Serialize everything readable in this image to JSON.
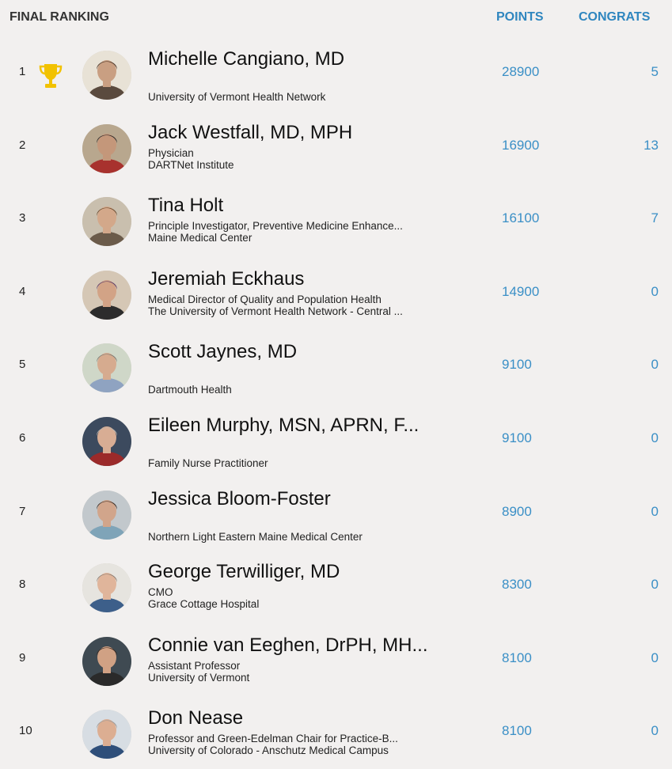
{
  "header": {
    "title": "FINAL RANKING",
    "points_label": "POINTS",
    "congrats_label": "CONGRATS"
  },
  "colors": {
    "accent": "#2f86bf",
    "trophy": "#f2c200",
    "background": "#f2f0ef"
  },
  "rows": [
    {
      "rank": "1",
      "name": "Michelle Cangiano, MD",
      "line1": "University of Vermont Health Network",
      "line2": "",
      "points": "28900",
      "congrats": "5",
      "trophy": true,
      "avatar": {
        "bg": "#e8e2d6",
        "hair": "#4a3527",
        "skin": "#c99f82",
        "shirt": "#5a4a3e"
      }
    },
    {
      "rank": "2",
      "name": "Jack Westfall, MD, MPH",
      "line1": "Physician",
      "line2": "DARTNet Institute",
      "points": "16900",
      "congrats": "13",
      "trophy": false,
      "avatar": {
        "bg": "#b8a78e",
        "hair": "#2e2a2a",
        "skin": "#c4977a",
        "shirt": "#a8322e"
      }
    },
    {
      "rank": "3",
      "name": "Tina Holt",
      "line1": "Principle Investigator, Preventive Medicine Enhance...",
      "line2": "Maine Medical Center",
      "points": "16100",
      "congrats": "7",
      "trophy": false,
      "avatar": {
        "bg": "#c9bfae",
        "hair": "#6a4a2e",
        "skin": "#d3a88a",
        "shirt": "#6b5b4a"
      }
    },
    {
      "rank": "4",
      "name": "Jeremiah Eckhaus",
      "line1": "Medical Director of Quality and Population Health",
      "line2": "The University of Vermont Health Network - Central ...",
      "points": "14900",
      "congrats": "0",
      "trophy": false,
      "avatar": {
        "bg": "#d5c7b5",
        "hair": "#5a3a66",
        "skin": "#d2a386",
        "shirt": "#2c2c2c"
      }
    },
    {
      "rank": "5",
      "name": "Scott Jaynes, MD",
      "line1": "Dartmouth Health",
      "line2": "",
      "points": "9100",
      "congrats": "0",
      "trophy": false,
      "avatar": {
        "bg": "#cfd7c8",
        "hair": "#7b7b74",
        "skin": "#d6ab8f",
        "shirt": "#8fa3c1"
      }
    },
    {
      "rank": "6",
      "name": "Eileen Murphy, MSN, APRN, F...",
      "line1": "Family Nurse Practitioner",
      "line2": "",
      "points": "9100",
      "congrats": "0",
      "trophy": false,
      "avatar": {
        "bg": "#3c4a5e",
        "hair": "#b9b4ae",
        "skin": "#d8ad94",
        "shirt": "#9b2a2a"
      }
    },
    {
      "rank": "7",
      "name": "Jessica Bloom-Foster",
      "line1": "Northern Light Eastern Maine Medical Center",
      "line2": "",
      "points": "8900",
      "congrats": "0",
      "trophy": false,
      "avatar": {
        "bg": "#c2c8cc",
        "hair": "#3a2d25",
        "skin": "#d1a58b",
        "shirt": "#7fa4b8"
      }
    },
    {
      "rank": "8",
      "name": "George Terwilliger, MD",
      "line1": "CMO",
      "line2": "Grace Cottage Hospital",
      "points": "8300",
      "congrats": "0",
      "trophy": false,
      "avatar": {
        "bg": "#e6e4df",
        "hair": "#8a7e74",
        "skin": "#e0b59b",
        "shirt": "#3d5f8a"
      }
    },
    {
      "rank": "9",
      "name": "Connie van Eeghen, DrPH, MH...",
      "line1": "Assistant Professor",
      "line2": "University of Vermont",
      "points": "8100",
      "congrats": "0",
      "trophy": false,
      "avatar": {
        "bg": "#3f4a52",
        "hair": "#3a2a22",
        "skin": "#d0a184",
        "shirt": "#2a2a2a"
      }
    },
    {
      "rank": "10",
      "name": "Don Nease",
      "line1": "Professor and Green-Edelman Chair for Practice-B...",
      "line2": "University of Colorado - Anschutz Medical Campus",
      "points": "8100",
      "congrats": "0",
      "trophy": false,
      "avatar": {
        "bg": "#d7dde3",
        "hair": "#9c9a98",
        "skin": "#dcae92",
        "shirt": "#2f4f7a"
      }
    }
  ]
}
